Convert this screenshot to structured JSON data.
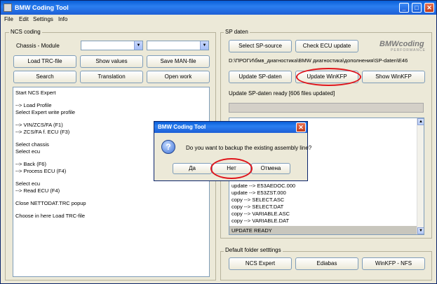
{
  "window": {
    "title": "BMW Coding Tool"
  },
  "menu": [
    "File",
    "Edit",
    "Settings",
    "Info"
  ],
  "ncs": {
    "group_label": "NCS coding",
    "chassis_label": "Chassis - Module",
    "buttons": {
      "load_trc": "Load TRC-file",
      "show_values": "Show values",
      "save_man": "Save MAN-file",
      "search": "Search",
      "translation": "Translation",
      "open_work": "Open work"
    },
    "log": [
      "Start NCS Expert",
      "",
      "--> Load Profile",
      "Select Expert write profile",
      "",
      "--> VIN/ZCS/FA (F1)",
      "--> ZCS/FA f. ECU (F3)",
      "",
      "Select chassis",
      "Select ecu",
      "",
      "--> Back (F6)",
      "--> Process ECU (F4)",
      "",
      "Select ecu",
      "--> Read ECU (F4)",
      "",
      "Close NETTODAT.TRC popup",
      "",
      "Choose in here Load TRC-file"
    ]
  },
  "sp": {
    "group_label": "SP daten",
    "select_source": "Select SP-source",
    "check_ecu_update": "Check ECU update",
    "logo_main": "BMWcoding",
    "logo_sub": "PERFORMANCE",
    "path": "D:\\ПРОГИ\\бмв_диагностика\\BMW диагностика\\дополнения\\SP-daten\\E46",
    "update_sp": "Update SP-daten",
    "update_winkfp": "Update WinKFP",
    "show_winkfp": "Show WinKFP",
    "status": "Update SP-daten ready [606 files updated]",
    "log": [
      "update --> E53AEDOC.000",
      "update --> E53ZST.000",
      "copy --> SELECT.ASC",
      "copy --> SELECT.DAT",
      "copy --> VARIABLE.ASC",
      "copy --> VARIABLE.DAT",
      "UPDATE READY"
    ]
  },
  "defaults": {
    "group_label": "Default folder setttings",
    "ncs_expert": "NCS Expert",
    "ediabas": "Ediabas",
    "winkfp_nfs": "WinKFP - NFS"
  },
  "dialog": {
    "title": "BMW Coding Tool",
    "message": "Do you want to backup the existing assembly line?",
    "yes": "Да",
    "no": "Нет",
    "cancel": "Отмена"
  },
  "colors": {
    "titlebar": "#1d5fd6",
    "highlight": "#e0141b",
    "window_bg": "#ece9d8"
  },
  "icons": {
    "question": "question-icon",
    "close": "close-icon"
  }
}
